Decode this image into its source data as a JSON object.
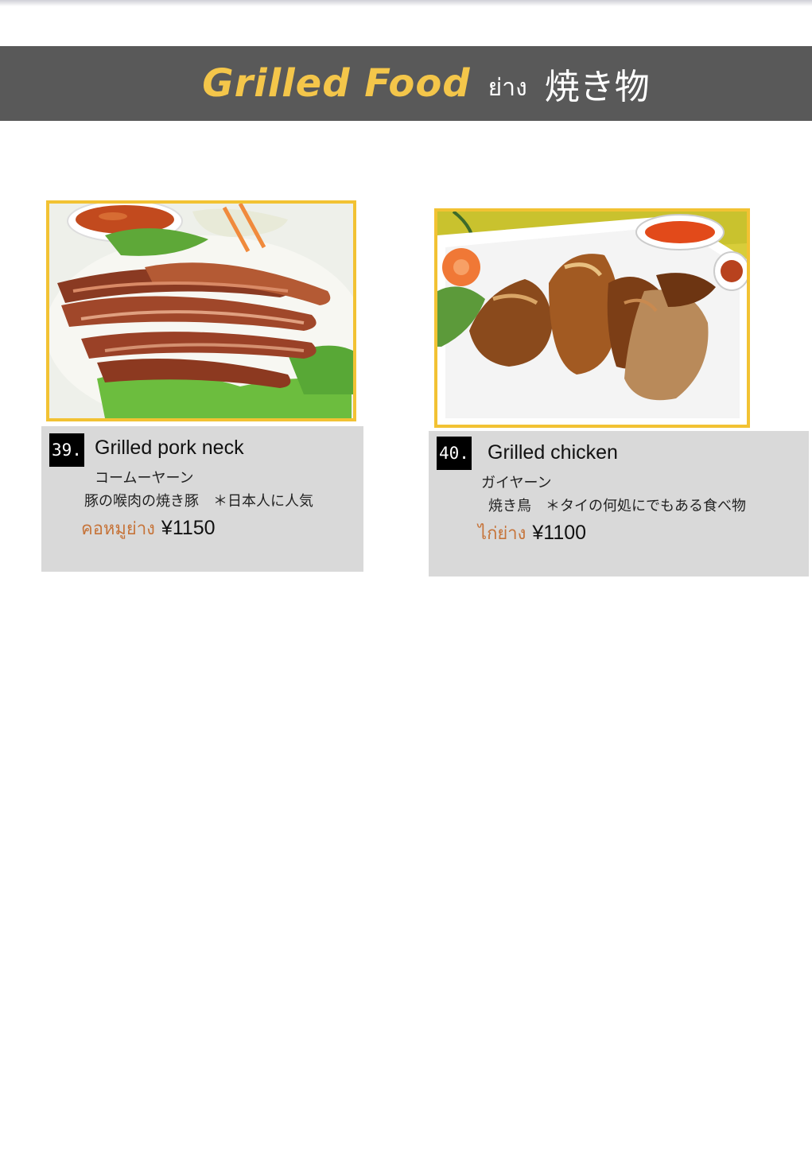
{
  "header": {
    "title_en": "Grilled Food",
    "title_th": "ย่าง",
    "title_jp": "焼き物",
    "colors": {
      "bar": "#595959",
      "title_accent": "#f4c64a"
    }
  },
  "items": [
    {
      "number": "39.",
      "name": "Grilled pork neck",
      "jp_reading": "コームーヤーン",
      "jp_description": "豚の喉肉の焼き豚　＊日本人に人気",
      "thai_name": "คอหมูย่าง",
      "price": "¥1150",
      "photo": "grilled-pork-neck-photo"
    },
    {
      "number": "40.",
      "name": "Grilled chicken",
      "jp_reading": "ガイヤーン",
      "jp_description": "焼き鳥　＊タイの何処にでもある食べ物",
      "thai_name": "ไก่ย่าง",
      "price": "¥1100",
      "photo": "grilled-chicken-photo"
    }
  ],
  "colors": {
    "photo_border": "#f2c233",
    "info_box": "#d9d9d9",
    "thai_text": "#c6743a"
  }
}
